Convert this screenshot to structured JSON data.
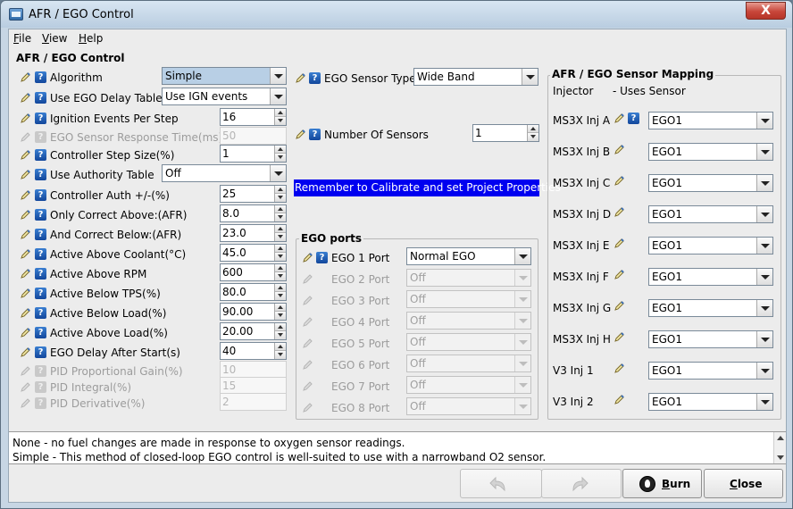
{
  "window": {
    "title": "AFR / EGO Control",
    "close_glyph": "X"
  },
  "menu": [
    {
      "label": "File",
      "mnemonic": "F",
      "rest": "ile"
    },
    {
      "label": "View",
      "mnemonic": "V",
      "rest": "iew"
    },
    {
      "label": "Help",
      "mnemonic": "H",
      "rest": "elp"
    }
  ],
  "main": {
    "section_title": "AFR / EGO Control",
    "left_rows": [
      {
        "label": "Algorithm",
        "kind": "combo",
        "value": "Simple",
        "enabled": true,
        "selected": true
      },
      {
        "label": "Use EGO Delay Table",
        "kind": "combo",
        "value": "Use IGN events",
        "enabled": true
      },
      {
        "label": "Ignition Events Per Step",
        "kind": "spin",
        "value": "16",
        "enabled": true
      },
      {
        "label": "EGO Sensor Response Time(ms)",
        "kind": "spin",
        "value": "50",
        "enabled": false
      },
      {
        "label": "Controller Step Size(%)",
        "kind": "spin",
        "value": "1",
        "enabled": true
      },
      {
        "label": "Use Authority Table",
        "kind": "combo",
        "value": "Off",
        "enabled": true
      },
      {
        "label": "Controller Auth +/-(%)",
        "kind": "spin",
        "value": "25",
        "enabled": true
      },
      {
        "label": "Only Correct Above:(AFR)",
        "kind": "spin",
        "value": "8.0",
        "enabled": true
      },
      {
        "label": "And Correct Below:(AFR)",
        "kind": "spin",
        "value": "23.0",
        "enabled": true
      },
      {
        "label": "Active Above Coolant(°C)",
        "kind": "spin",
        "value": "45.0",
        "enabled": true
      },
      {
        "label": "Active Above RPM",
        "kind": "spin",
        "value": "600",
        "enabled": true
      },
      {
        "label": "Active Below TPS(%)",
        "kind": "spin",
        "value": "80.0",
        "enabled": true
      },
      {
        "label": "Active Below Load(%)",
        "kind": "spin",
        "value": "90.00",
        "enabled": true
      },
      {
        "label": "Active Above Load(%)",
        "kind": "spin",
        "value": "20.00",
        "enabled": true
      },
      {
        "label": "EGO Delay After Start(s)",
        "kind": "spin",
        "value": "40",
        "enabled": true
      },
      {
        "label": "PID Proportional Gain(%)",
        "kind": "spin",
        "value": "10",
        "enabled": false
      },
      {
        "label": "PID Integral(%)",
        "kind": "spin",
        "value": "15",
        "enabled": false
      },
      {
        "label": "PID Derivative(%)",
        "kind": "spin",
        "value": "2",
        "enabled": false
      }
    ],
    "sensor_type": {
      "label": "EGO Sensor Type",
      "value": "Wide Band"
    },
    "num_sensors": {
      "label": "Number Of Sensors",
      "value": "1"
    },
    "banner": "Remember to Calibrate and set Project Properties",
    "ego_ports": {
      "title": "EGO ports",
      "ports": [
        {
          "label": "EGO 1 Port",
          "value": "Normal EGO",
          "enabled": true
        },
        {
          "label": "EGO 2 Port",
          "value": "Off",
          "enabled": false
        },
        {
          "label": "EGO 3 Port",
          "value": "Off",
          "enabled": false
        },
        {
          "label": "EGO 4 Port",
          "value": "Off",
          "enabled": false
        },
        {
          "label": "EGO 5 Port",
          "value": "Off",
          "enabled": false
        },
        {
          "label": "EGO 6 Port",
          "value": "Off",
          "enabled": false
        },
        {
          "label": "EGO 7 Port",
          "value": "Off",
          "enabled": false
        },
        {
          "label": "EGO 8 Port",
          "value": "Off",
          "enabled": false
        }
      ]
    },
    "mapping": {
      "title": "AFR / EGO Sensor Mapping",
      "header_injector": "Injector",
      "header_sensor": "- Uses Sensor",
      "rows": [
        {
          "label": "MS3X Inj A",
          "value": "EGO1",
          "help": true
        },
        {
          "label": "MS3X Inj B",
          "value": "EGO1"
        },
        {
          "label": "MS3X Inj C",
          "value": "EGO1"
        },
        {
          "label": "MS3X Inj D",
          "value": "EGO1"
        },
        {
          "label": "MS3X Inj E",
          "value": "EGO1"
        },
        {
          "label": "MS3X Inj F",
          "value": "EGO1"
        },
        {
          "label": "MS3X Inj G",
          "value": "EGO1"
        },
        {
          "label": "MS3X Inj H",
          "value": "EGO1"
        },
        {
          "label": "V3 Inj 1",
          "value": "EGO1"
        },
        {
          "label": "V3 Inj 2",
          "value": "EGO1"
        }
      ]
    }
  },
  "description": {
    "lines": [
      "None - no fuel changes are made in response to oxygen sensor readings.",
      "Simple - This method of closed-loop EGO control is well-suited to use with a narrowband O2 sensor."
    ]
  },
  "buttons": {
    "undo_icon": "undo-arrow-icon",
    "redo_icon": "redo-arrow-icon",
    "burn": {
      "label": "Burn",
      "mnemonic": "B",
      "rest": "urn"
    },
    "close": {
      "label": "Close",
      "mnemonic": "C",
      "rest": "lose"
    }
  },
  "colors": {
    "banner_bg": "#0000f0",
    "selected_combo": "#b8cfe5",
    "close_button": "#c8463a"
  }
}
